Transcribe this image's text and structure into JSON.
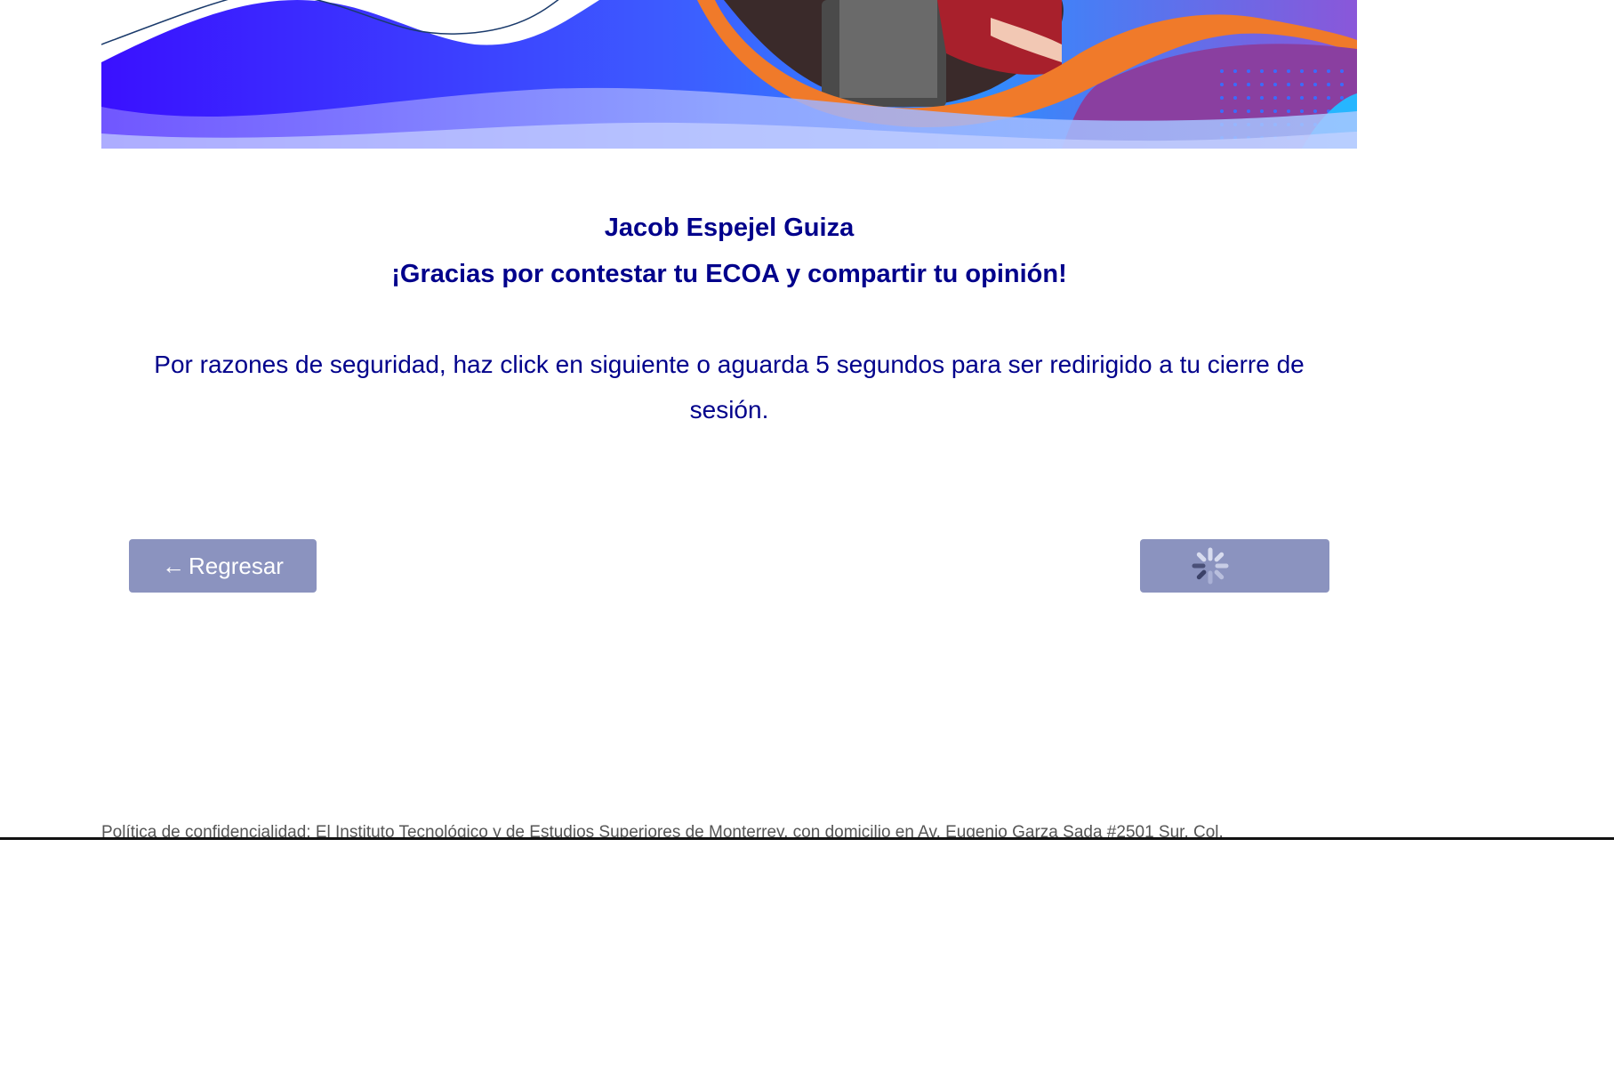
{
  "student": {
    "name": "Jacob Espejel Guiza"
  },
  "messages": {
    "thanks": "¡Gracias por contestar tu ECOA y compartir tu opinión!",
    "notice": "Por razones de seguridad, haz click en siguiente o aguarda 5 segundos para ser redirigido a tu cierre de sesión."
  },
  "buttons": {
    "back_arrow": "←",
    "back_label": "Regresar",
    "next_icon": "loading-spinner-icon"
  },
  "footer": {
    "privacy_text": "Política de confidencialidad: El Instituto Tecnológico y de Estudios Superiores de Monterrey, con domicilio en Av. Eugenio Garza Sada #2501 Sur, Col."
  },
  "colors": {
    "primary_text": "#00008b",
    "button_bg": "#8b93bf",
    "banner_purple": "#3a10ff",
    "banner_blue": "#2f8cff",
    "banner_orange": "#f07a2a"
  }
}
